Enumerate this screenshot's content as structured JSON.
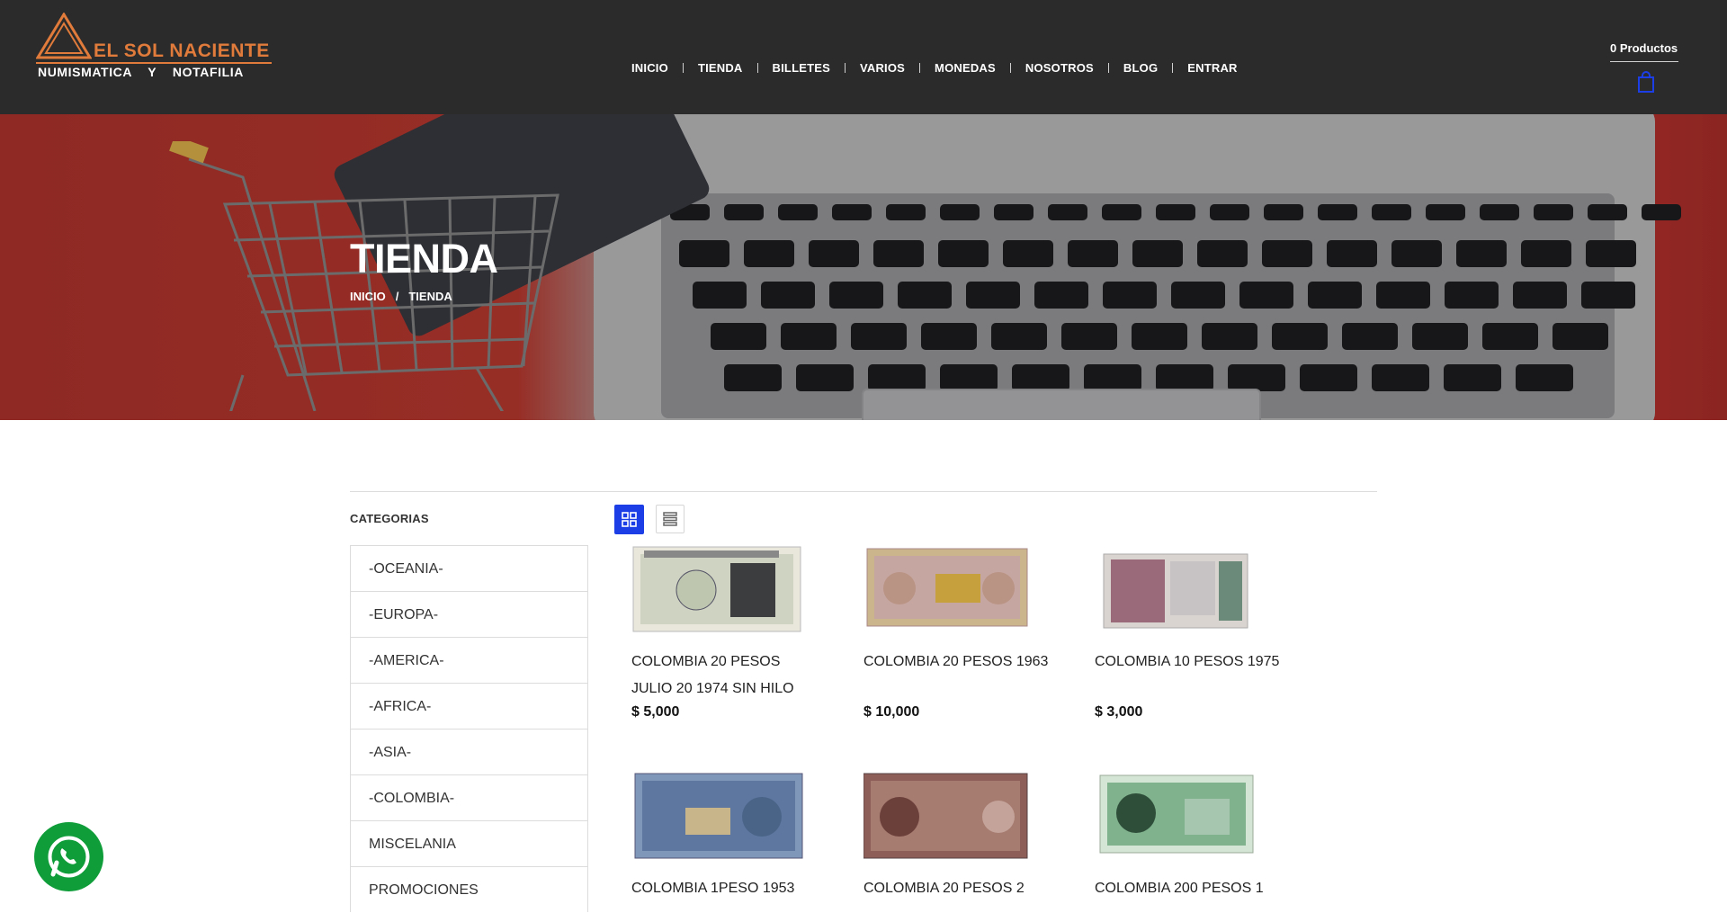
{
  "brand": {
    "name": "EL SOL NACIENTE",
    "tagline": "NUMISMATICA    Y    NOTAFILIA",
    "accent_color": "#e07b3b"
  },
  "nav": {
    "items": [
      "INICIO",
      "TIENDA",
      "BILLETES",
      "VARIOS",
      "MONEDAS",
      "NOSOTROS",
      "BLOG",
      "ENTRAR"
    ]
  },
  "cart": {
    "count_label": "0 Productos",
    "icon": "shopping-bag-icon",
    "color": "#1b3ee6"
  },
  "hero": {
    "title": "TIENDA",
    "breadcrumb": [
      "INICIO",
      "TIENDA"
    ],
    "separator": "/"
  },
  "sidebar": {
    "title": "CATEGORIAS",
    "categories": [
      "-OCEANIA-",
      "-EUROPA-",
      "-AMERICA-",
      "-AFRICA-",
      "-ASIA-",
      "-COLOMBIA-",
      "MISCELANIA",
      "PROMOCIONES"
    ]
  },
  "view_toggle": {
    "active": "grid",
    "grid_icon": "grid-view-icon",
    "list_icon": "list-view-icon",
    "active_color": "#1b3ee6"
  },
  "products": [
    {
      "title": "COLOMBIA 20 PESOS JULIO 20 1974 SIN HILO",
      "price": "$ 5,000",
      "image": "banknote-image"
    },
    {
      "title": "COLOMBIA 20 PESOS 1963",
      "price": "$ 10,000",
      "image": "banknote-image"
    },
    {
      "title": "COLOMBIA 10 PESOS 1975",
      "price": "$ 3,000",
      "image": "banknote-image"
    },
    {
      "title": "COLOMBIA 1PESO 1953",
      "price": "",
      "image": "banknote-image"
    },
    {
      "title": "COLOMBIA 20 PESOS 2",
      "price": "",
      "image": "banknote-image"
    },
    {
      "title": "COLOMBIA 200 PESOS 1",
      "price": "",
      "image": "banknote-image"
    }
  ],
  "whatsapp": {
    "icon": "whatsapp-icon",
    "color": "#0f9d3a"
  }
}
